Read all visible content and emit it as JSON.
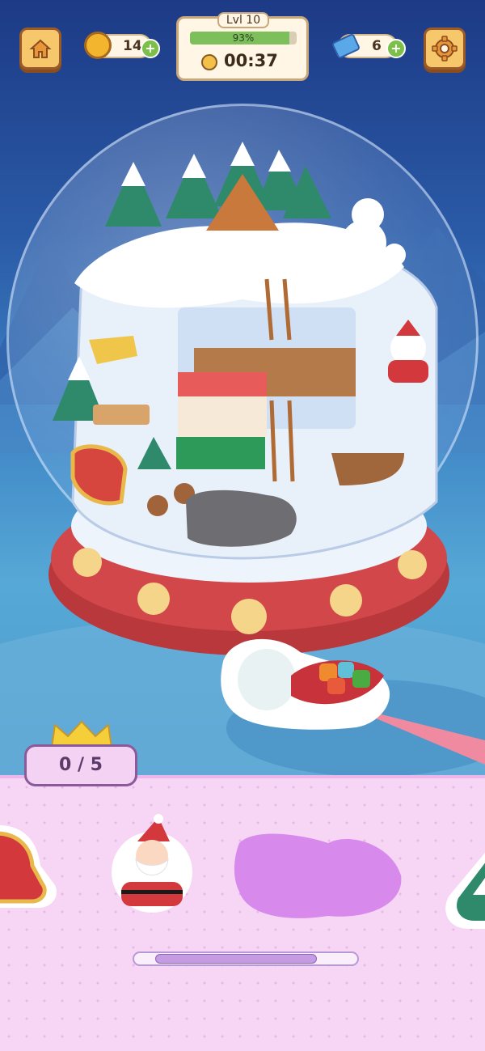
{
  "hud": {
    "coins": "14",
    "tickets": "6",
    "level_label": "Lvl 10",
    "progress_text": "93%",
    "progress_value": 0.93,
    "timer": "00:37"
  },
  "collection": {
    "counter": "0 / 5"
  },
  "tray": {
    "items": [
      "sleigh-icon",
      "santa-icon",
      "hidden-item-icon",
      "tree-icon"
    ]
  },
  "colors": {
    "bottom_panel": "#f6d6f4",
    "accent_button": "#f7c76b",
    "progress_fill": "#7cbf5b",
    "globe_base": "#d2474a"
  }
}
